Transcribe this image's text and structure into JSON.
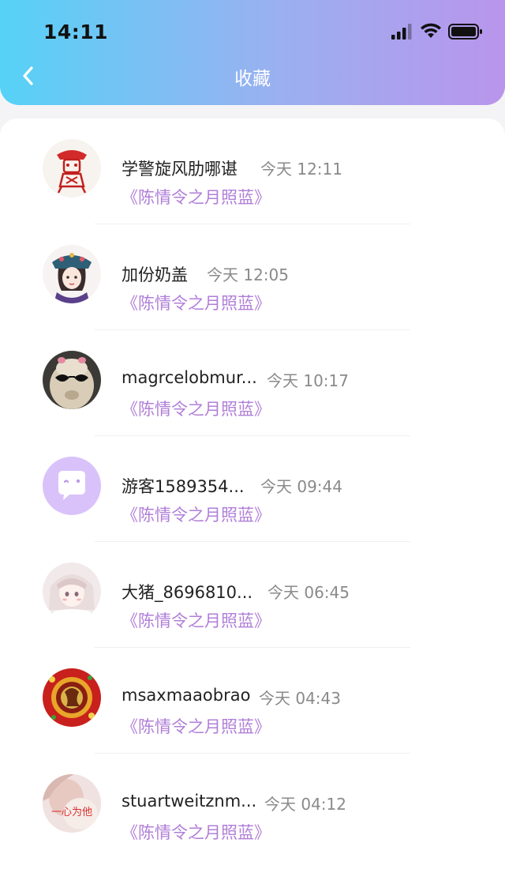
{
  "status_bar": {
    "time": "14:11"
  },
  "nav": {
    "title": "收藏",
    "back_icon": "chevron-left-icon"
  },
  "colors": {
    "header_gradient_start": "#56d2f7",
    "header_gradient_end": "#b995ec",
    "title_purple": "#b07fd8",
    "timestamp_gray": "#8a8a8a"
  },
  "items": [
    {
      "name": "学警旋风肋哪谌",
      "time": "今天 12:11",
      "title": "《陈情令之月照蓝》",
      "avatar": "red-paper-cut-avatar"
    },
    {
      "name": "加份奶盖",
      "time": "今天 12:05",
      "title": "《陈情令之月照蓝》",
      "avatar": "qing-princess-avatar"
    },
    {
      "name": "magrcelobmur...",
      "time": "今天 10:17",
      "title": "《陈情令之月照蓝》",
      "avatar": "alpaca-sunglasses-avatar"
    },
    {
      "name": "游客1589354...",
      "time": "今天 09:44",
      "title": "《陈情令之月照蓝》",
      "avatar": "default-chat-avatar"
    },
    {
      "name": "大猪_8696810...",
      "time": "今天 06:45",
      "title": "《陈情令之月照蓝》",
      "avatar": "anime-girl-avatar"
    },
    {
      "name": "msaxmaaobrao",
      "time": "今天 04:43",
      "title": "《陈情令之月照蓝》",
      "avatar": "red-gold-emblem-avatar"
    },
    {
      "name": "stuartweitznm...",
      "time": "今天 04:12",
      "title": "《陈情令之月照蓝》",
      "avatar": "photo-text-avatar",
      "avatar_text": "一心为他"
    }
  ]
}
